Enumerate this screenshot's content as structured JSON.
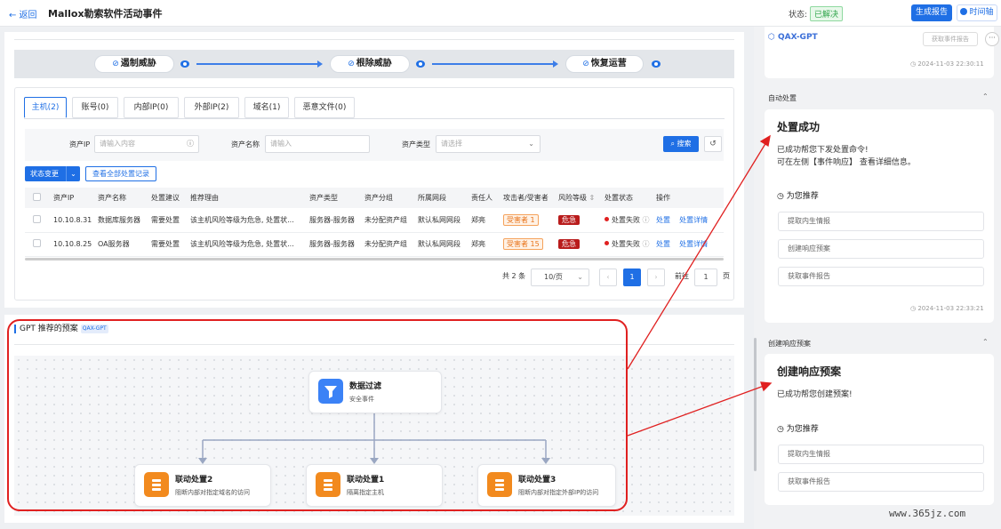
{
  "header": {
    "back_label": "← 返回",
    "title": "Mallox勒索软件活动事件",
    "status_label": "状态:",
    "status_value": "已解决",
    "report_button": "生成报告",
    "timeline_button": "时间轴"
  },
  "stages": [
    "遏制威胁",
    "根除威胁",
    "恢复运营"
  ],
  "tabs": [
    "主机(2)",
    "账号(0)",
    "内部IP(0)",
    "外部IP(2)",
    "域名(1)",
    "恶意文件(0)"
  ],
  "filter": {
    "ip_label": "资产IP",
    "ip_placeholder": "请输入内容",
    "name_label": "资产名称",
    "name_placeholder": "请输入",
    "type_label": "资产类型",
    "type_placeholder": "请选择",
    "search_button": "搜索"
  },
  "actions": {
    "state_change": "状态变更",
    "view_all": "查看全部处置记录"
  },
  "table": {
    "headers": [
      "资产IP",
      "资产名称",
      "处置建议",
      "推荐理由",
      "资产类型",
      "资产分组",
      "所属网段",
      "责任人",
      "攻击者/受害者",
      "风险等级",
      "处置状态",
      "操作"
    ],
    "rows": [
      {
        "ip": "10.10.8.31",
        "name": "数据库服务器",
        "advice": "需要处置",
        "reason": "该主机风险等级为危急, 处置状...",
        "type": "服务器-服务器",
        "group": "未分配资产组",
        "segment": "默认私网网段",
        "owner": "郑亮",
        "role": "受害者 1",
        "risk": "危急",
        "state": "处置失败",
        "op1": "处置",
        "op2": "处置详情"
      },
      {
        "ip": "10.10.8.25",
        "name": "OA服务器",
        "advice": "需要处置",
        "reason": "该主机风险等级为危急, 处置状...",
        "type": "服务器-服务器",
        "group": "未分配资产组",
        "segment": "默认私网网段",
        "owner": "郑亮",
        "role": "受害者 15",
        "risk": "危急",
        "state": "处置失败",
        "op1": "处置",
        "op2": "处置详情"
      }
    ]
  },
  "pagination": {
    "total": "共 2 条",
    "page_size": "10/页",
    "current": "1",
    "goto_label": "前往",
    "goto_value": "1",
    "page_unit": "页"
  },
  "gpt": {
    "title": "GPT 推荐的预案",
    "badge": "QAX-GPT",
    "root": {
      "title": "数据过滤",
      "sub": "安全事件"
    },
    "children": [
      {
        "title": "联动处置2",
        "sub": "阻断内部对指定域名的访问"
      },
      {
        "title": "联动处置1",
        "sub": "隔离指定主机"
      },
      {
        "title": "联动处置3",
        "sub": "阻断内部对指定外部IP的访问"
      }
    ]
  },
  "right": {
    "brand": "QAX-GPT",
    "fetch_report": "获取事件报告",
    "ts1": "2024-11-03 22:30:11",
    "section1_label": "自动处置",
    "card1_title": "处置成功",
    "card1_line1": "已成功帮您下发处置命令!",
    "card1_line2": "可在左侧【事件响应】 查看详细信息。",
    "recommend_label": "为您推荐",
    "card1_recs": [
      "提取内生情报",
      "创建响应预案",
      "获取事件报告"
    ],
    "ts2": "2024-11-03 22:33:21",
    "section2_label": "创建响应预案",
    "card2_title": "创建响应预案",
    "card2_line1": "已成功帮您创建预案!",
    "card2_recs": [
      "提取内生情报",
      "获取事件报告"
    ]
  },
  "watermark": "www.365jz.com",
  "colors": {
    "primary": "#1f6fe5",
    "danger": "#b91c1c",
    "annotation": "#e02020",
    "success": "#2fa44a"
  }
}
